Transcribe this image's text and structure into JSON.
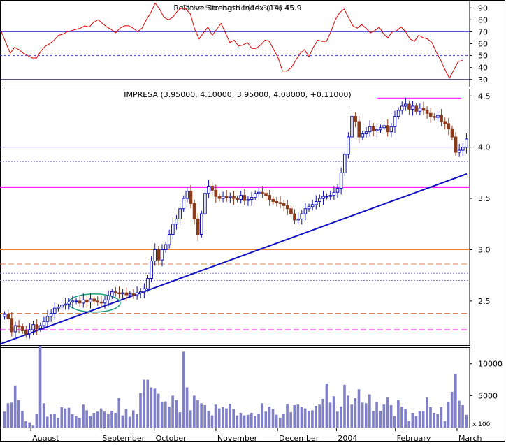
{
  "chart_data": [
    {
      "type": "line",
      "panel": "indicator",
      "title": "Relative Strength Index (14) 45.9",
      "title_overlap": "Close Stochastic (14,3) 76.50",
      "y_ticks": [
        "30",
        "40",
        "50",
        "60",
        "70",
        "80",
        "90"
      ],
      "y_tick_values": [
        30,
        40,
        50,
        60,
        70,
        80,
        90
      ],
      "ylim": [
        24,
        96
      ],
      "reference_lines": [
        {
          "value": 70,
          "style": "solid",
          "color": "#4040c0"
        },
        {
          "value": 50,
          "style": "dotted",
          "color": "#4040c0"
        },
        {
          "value": 30,
          "style": "solid",
          "color": "#202060"
        }
      ],
      "line_color": "#e00000",
      "series": [
        {
          "values": [
            70,
            61,
            52,
            57,
            55,
            52,
            50,
            48,
            48,
            54,
            58,
            60,
            63,
            67,
            68,
            70,
            71,
            72,
            73,
            75,
            74,
            78,
            80,
            77,
            74,
            72,
            69,
            73,
            75,
            75,
            73,
            70,
            73,
            80,
            86,
            94,
            89,
            82,
            80,
            82,
            87,
            90,
            89,
            85,
            72,
            64,
            69,
            74,
            67,
            72,
            77,
            69,
            61,
            63,
            58,
            59,
            61,
            56,
            56,
            59,
            63,
            62,
            55,
            48,
            37,
            37,
            40,
            46,
            52,
            55,
            49,
            57,
            63,
            62,
            62,
            70,
            80,
            86,
            89,
            82,
            75,
            73,
            76,
            73,
            69,
            71,
            74,
            68,
            65,
            70,
            71,
            74,
            70,
            64,
            62,
            67,
            65,
            64,
            61,
            53,
            46,
            38,
            31,
            38,
            45,
            46
          ]
        }
      ]
    },
    {
      "type": "candlestick",
      "panel": "price",
      "title": "IMPRESA (3.95000, 4.10000, 3.95000, 4.08000, +0.11000)",
      "y_ticks": [
        "2.5",
        "3.0",
        "3.5",
        "4.0",
        "4.5"
      ],
      "y_tick_values": [
        2.5,
        3.0,
        3.5,
        4.0,
        4.5
      ],
      "ylim": [
        2.07,
        4.57
      ],
      "up_color": "#1010b0",
      "down_color": "#8b3a1a",
      "closes": [
        2.37,
        2.33,
        2.2,
        2.26,
        2.25,
        2.21,
        2.18,
        2.22,
        2.27,
        2.23,
        2.26,
        2.3,
        2.35,
        2.38,
        2.43,
        2.44,
        2.46,
        2.47,
        2.49,
        2.5,
        2.5,
        2.48,
        2.51,
        2.49,
        2.52,
        2.5,
        2.49,
        2.48,
        2.51,
        2.55,
        2.59,
        2.58,
        2.57,
        2.58,
        2.56,
        2.57,
        2.56,
        2.58,
        2.59,
        2.62,
        2.72,
        2.89,
        3.0,
        2.9,
        3.0,
        3.05,
        3.15,
        3.25,
        3.3,
        3.4,
        3.5,
        3.57,
        3.45,
        3.3,
        3.15,
        3.35,
        3.55,
        3.62,
        3.58,
        3.52,
        3.5,
        3.52,
        3.51,
        3.52,
        3.5,
        3.49,
        3.53,
        3.48,
        3.49,
        3.51,
        3.55,
        3.56,
        3.55,
        3.53,
        3.49,
        3.47,
        3.46,
        3.45,
        3.43,
        3.4,
        3.35,
        3.29,
        3.3,
        3.35,
        3.4,
        3.42,
        3.44,
        3.47,
        3.5,
        3.52,
        3.52,
        3.53,
        3.56,
        3.6,
        3.75,
        3.93,
        4.1,
        4.3,
        4.25,
        4.1,
        4.13,
        4.15,
        4.2,
        4.16,
        4.17,
        4.19,
        4.21,
        4.15,
        4.2,
        4.3,
        4.36,
        4.4,
        4.42,
        4.37,
        4.4,
        4.35,
        4.38,
        4.36,
        4.33,
        4.3,
        4.29,
        4.31,
        4.25,
        4.23,
        4.18,
        4.1,
        3.95,
        3.97,
        4.0,
        4.08
      ]
    },
    {
      "type": "bar",
      "panel": "volume",
      "y_ticks": [
        "5000",
        "10000"
      ],
      "y_tick_values": [
        5000,
        10000
      ],
      "ylim": [
        0,
        12600
      ],
      "multiplier_label": "x 100",
      "bar_color": "#8080c8",
      "x_labels": [
        "August",
        "September",
        "October",
        "November",
        "December",
        "2004",
        "February",
        "March"
      ],
      "values": [
        2500,
        3800,
        3900,
        6600,
        4300,
        2600,
        1000,
        800,
        300,
        2200,
        12800,
        3800,
        1700,
        2100,
        2200,
        1500,
        3200,
        3000,
        3100,
        2100,
        1800,
        1500,
        3600,
        2700,
        1800,
        2300,
        2500,
        3000,
        2500,
        2100,
        2600,
        2300,
        4600,
        1900,
        2900,
        1700,
        2700,
        2100,
        5400,
        7500,
        7500,
        6300,
        6100,
        5300,
        4000,
        4100,
        3300,
        5000,
        4300,
        2400,
        11900,
        6300,
        2700,
        5000,
        4300,
        3800,
        3500,
        2600,
        1900,
        3600,
        3000,
        3200,
        3000,
        3700,
        2900,
        1900,
        2300,
        1900,
        2000,
        2300,
        1800,
        2200,
        3800,
        2500,
        3300,
        2900,
        2000,
        1500,
        2200,
        3700,
        2400,
        3500,
        3600,
        3200,
        3000,
        2600,
        2700,
        3400,
        3600,
        4500,
        6900,
        3900,
        4900,
        2500,
        3300,
        6700,
        5000,
        3600,
        4600,
        6000,
        3900,
        3800,
        5200,
        2600,
        4000,
        2600,
        3600,
        4700,
        3500,
        1800,
        4300,
        3300,
        2900,
        1000,
        2300,
        1800,
        2600,
        2600,
        4700,
        3200,
        2300,
        2100,
        3200,
        1000,
        4000,
        5600,
        8400,
        4200,
        3500,
        2000
      ]
    }
  ]
}
